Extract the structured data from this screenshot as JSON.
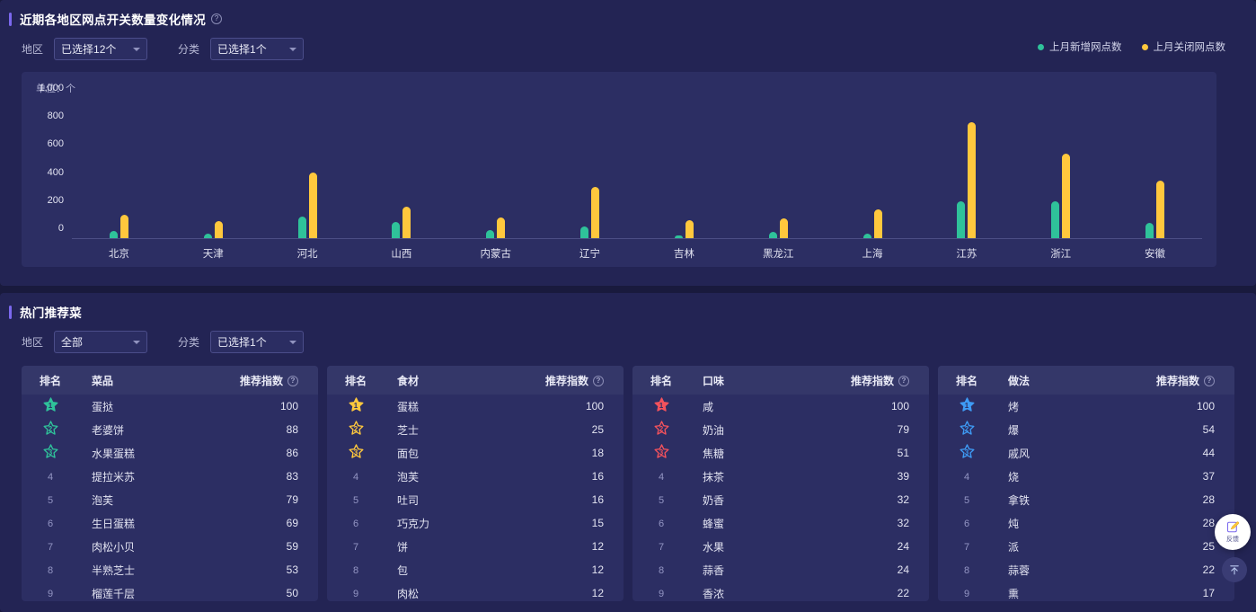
{
  "chart_section": {
    "title": "近期各地区网点开关数量变化情况",
    "help_icon": "help-circle-icon",
    "filters": [
      {
        "label": "地区",
        "value": "已选择12个"
      },
      {
        "label": "分类",
        "value": "已选择1个"
      }
    ],
    "legend": [
      {
        "label": "上月新增网点数",
        "color": "#2fc29a"
      },
      {
        "label": "上月关闭网点数",
        "color": "#ffc83d"
      }
    ],
    "unit": "单位：个"
  },
  "chart_data": {
    "type": "bar",
    "title": "近期各地区网点开关数量变化情况",
    "xlabel": "",
    "ylabel": "个",
    "ylim": [
      0,
      1000
    ],
    "yticks": [
      "0",
      "200",
      "400",
      "600",
      "800",
      "1,000"
    ],
    "grid": false,
    "legend_position": "top-right",
    "categories": [
      "北京",
      "天津",
      "河北",
      "山西",
      "内蒙古",
      "辽宁",
      "吉林",
      "黑龙江",
      "上海",
      "江苏",
      "浙江",
      "安徽"
    ],
    "series": [
      {
        "name": "上月新增网点数",
        "color": "#2fc29a",
        "values": [
          53,
          30,
          152,
          113,
          60,
          86,
          20,
          42,
          33,
          265,
          265,
          106
        ]
      },
      {
        "name": "上月关闭网点数",
        "color": "#ffc83d",
        "values": [
          167,
          119,
          470,
          225,
          146,
          364,
          126,
          139,
          206,
          827,
          604,
          410
        ]
      }
    ]
  },
  "tables_section": {
    "title": "热门推荐菜",
    "filters": [
      {
        "label": "地区",
        "value": "全部"
      },
      {
        "label": "分类",
        "value": "已选择1个"
      }
    ],
    "tables": [
      {
        "star_color": "#2fc29a",
        "headers": {
          "rank": "排名",
          "name": "菜品",
          "score": "推荐指数"
        },
        "rows": [
          {
            "rank": "1",
            "name": "蛋挞",
            "score": "100"
          },
          {
            "rank": "2",
            "name": "老婆饼",
            "score": "88"
          },
          {
            "rank": "3",
            "name": "水果蛋糕",
            "score": "86"
          },
          {
            "rank": "4",
            "name": "提拉米苏",
            "score": "83"
          },
          {
            "rank": "5",
            "name": "泡芙",
            "score": "79"
          },
          {
            "rank": "6",
            "name": "生日蛋糕",
            "score": "69"
          },
          {
            "rank": "7",
            "name": "肉松小贝",
            "score": "59"
          },
          {
            "rank": "8",
            "name": "半熟芝士",
            "score": "53"
          },
          {
            "rank": "9",
            "name": "榴莲千层",
            "score": "50"
          }
        ]
      },
      {
        "star_color": "#ffc83d",
        "headers": {
          "rank": "排名",
          "name": "食材",
          "score": "推荐指数"
        },
        "rows": [
          {
            "rank": "1",
            "name": "蛋糕",
            "score": "100"
          },
          {
            "rank": "2",
            "name": "芝士",
            "score": "25"
          },
          {
            "rank": "3",
            "name": "面包",
            "score": "18"
          },
          {
            "rank": "4",
            "name": "泡芙",
            "score": "16"
          },
          {
            "rank": "5",
            "name": "吐司",
            "score": "16"
          },
          {
            "rank": "6",
            "name": "巧克力",
            "score": "15"
          },
          {
            "rank": "7",
            "name": "饼",
            "score": "12"
          },
          {
            "rank": "8",
            "name": "包",
            "score": "12"
          },
          {
            "rank": "9",
            "name": "肉松",
            "score": "12"
          }
        ]
      },
      {
        "star_color": "#f4525c",
        "headers": {
          "rank": "排名",
          "name": "口味",
          "score": "推荐指数"
        },
        "rows": [
          {
            "rank": "1",
            "name": "咸",
            "score": "100"
          },
          {
            "rank": "2",
            "name": "奶油",
            "score": "79"
          },
          {
            "rank": "3",
            "name": "焦糖",
            "score": "51"
          },
          {
            "rank": "4",
            "name": "抹茶",
            "score": "39"
          },
          {
            "rank": "5",
            "name": "奶香",
            "score": "32"
          },
          {
            "rank": "6",
            "name": "蜂蜜",
            "score": "32"
          },
          {
            "rank": "7",
            "name": "水果",
            "score": "24"
          },
          {
            "rank": "8",
            "name": "蒜香",
            "score": "24"
          },
          {
            "rank": "9",
            "name": "香浓",
            "score": "22"
          }
        ]
      },
      {
        "star_color": "#3e9bf5",
        "headers": {
          "rank": "排名",
          "name": "做法",
          "score": "推荐指数"
        },
        "rows": [
          {
            "rank": "1",
            "name": "烤",
            "score": "100"
          },
          {
            "rank": "2",
            "name": "爆",
            "score": "54"
          },
          {
            "rank": "3",
            "name": "戚风",
            "score": "44"
          },
          {
            "rank": "4",
            "name": "烧",
            "score": "37"
          },
          {
            "rank": "5",
            "name": "拿铁",
            "score": "28"
          },
          {
            "rank": "6",
            "name": "炖",
            "score": "28"
          },
          {
            "rank": "7",
            "name": "派",
            "score": "25"
          },
          {
            "rank": "8",
            "name": "蒜蓉",
            "score": "22"
          },
          {
            "rank": "9",
            "name": "熏",
            "score": "17"
          }
        ]
      }
    ]
  },
  "floating": {
    "feedback_label": "反馈",
    "feedback_icon": "edit-pencil-icon",
    "back_to_top_icon": "arrow-up-icon"
  }
}
